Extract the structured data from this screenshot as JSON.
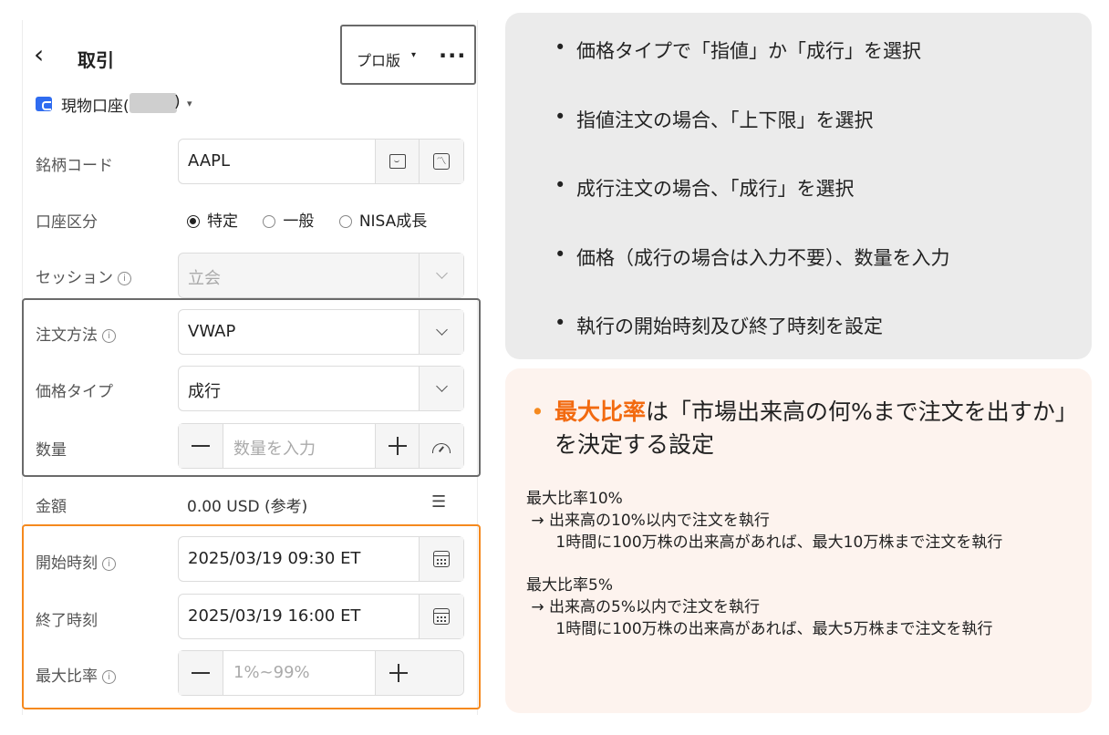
{
  "header": {
    "back_icon": "‹",
    "title": "取引",
    "pro_label": "プロ版",
    "pro_caret": "▾",
    "more_label": "···"
  },
  "account": {
    "name": "現物口座(",
    "close": ")",
    "caret": "▾"
  },
  "form": {
    "symbol_label": "銘柄コード",
    "symbol_value": "AAPL",
    "acct_type_label": "口座区分",
    "acct_options": [
      "特定",
      "一般",
      "NISA成長"
    ],
    "session_label": "セッション",
    "session_value": "立会",
    "order_method_label": "注文方法",
    "order_method_value": "VWAP",
    "price_type_label": "価格タイプ",
    "price_type_value": "成行",
    "qty_label": "数量",
    "qty_placeholder": "数量を入力",
    "amount_label": "金額",
    "amount_value": "0.00 USD (参考)",
    "start_label": "開始時刻",
    "start_value": "2025/03/19 09:30 ET",
    "end_label": "終了時刻",
    "end_value": "2025/03/19 16:00 ET",
    "max_ratio_label": "最大比率",
    "max_ratio_placeholder": "1%~99%",
    "info_glyph": "i"
  },
  "right_top": {
    "bullets": [
      "価格タイプで「指値」か「成行」を選択",
      "指値注文の場合、「上下限」を選択",
      "成行注文の場合、「成行」を選択",
      "価格（成行の場合は入力不要）、数量を入力",
      "執行の開始時刻及び終了時刻を設定"
    ]
  },
  "right_bottom": {
    "headline_highlight": "最大比率",
    "headline_rest": "は「市場出来高の何%まで注文を出すか」を決定する設定",
    "note1_title": "最大比率10%",
    "note1_line1": " → 出来高の10%以内で注文を執行",
    "note1_line2": "      1時間に100万株の出来高があれば、最大10万株まで注文を執行",
    "note2_title": "最大比率5%",
    "note2_line1": " → 出来高の5%以内で注文を執行",
    "note2_line2": "      1時間に100万株の出来高があれば、最大5万株まで注文を執行"
  },
  "colors": {
    "accent_orange": "#f5891e",
    "highlight_orange": "#f26a10",
    "account_blue": "#2f6cf0"
  }
}
